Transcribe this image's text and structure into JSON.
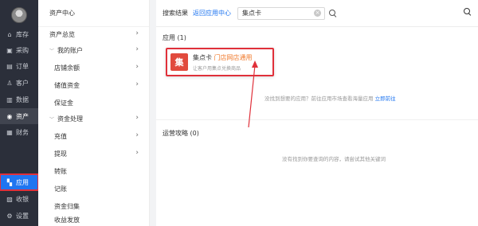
{
  "nav": {
    "items": [
      {
        "label": "库存",
        "icon": "home-icon",
        "glyph": "⌂"
      },
      {
        "label": "采购",
        "icon": "shop-icon",
        "glyph": "▣"
      },
      {
        "label": "订单",
        "icon": "order-icon",
        "glyph": "▤"
      },
      {
        "label": "客户",
        "icon": "user-icon",
        "glyph": "♙"
      },
      {
        "label": "数据",
        "icon": "chart-icon",
        "glyph": "▥"
      },
      {
        "label": "资产",
        "icon": "asset-icon",
        "glyph": "◉"
      },
      {
        "label": "财务",
        "icon": "finance-icon",
        "glyph": "▦"
      },
      {
        "label": "应用",
        "icon": "apps-icon",
        "glyph": "▚"
      },
      {
        "label": "收银",
        "icon": "cashier-icon",
        "glyph": "▨"
      },
      {
        "label": "设置",
        "icon": "settings-icon",
        "glyph": "⚙"
      }
    ]
  },
  "submenu": {
    "header": "资产中心",
    "items": [
      {
        "label": "资产总览",
        "chevron": "›"
      },
      {
        "label": "我的账户",
        "chevron": "›",
        "expanded": true
      },
      {
        "label": "店铺余额",
        "chevron": "›"
      },
      {
        "label": "储值资金",
        "chevron": "›"
      },
      {
        "label": "保证金",
        "chevron": ""
      },
      {
        "label": "资金处理",
        "chevron": "›",
        "expanded": true
      },
      {
        "label": "充值",
        "chevron": "›"
      },
      {
        "label": "提现",
        "chevron": "›"
      },
      {
        "label": "转账",
        "chevron": ""
      },
      {
        "label": "记账",
        "chevron": ""
      },
      {
        "label": "资金归集",
        "chevron": ""
      },
      {
        "label": "收益发放",
        "chevron": ""
      }
    ]
  },
  "topbar": {
    "title": "搜索结果",
    "back_link": "返回应用中心",
    "search_value": "集点卡",
    "clear_glyph": "×"
  },
  "apps_section": {
    "title": "应用 (1)",
    "card": {
      "icon_text": "集",
      "name": "集点卡",
      "tag": "门店网店通用",
      "desc": "让客户用集点兑换商品"
    },
    "empty_tip": "没找到想要的应用？前往应用市场查看海量应用",
    "empty_link": "立即前往"
  },
  "guides_section": {
    "title": "运营攻略 (0)",
    "empty_tip": "没有找到你要查询的内容，请尝试其他关键词"
  },
  "colors": {
    "nav_bg": "#2b2f3a",
    "accent": "#1f75f0",
    "highlight_border": "#e0303a",
    "app_icon": "#e14a3d",
    "tag": "#f07a2c"
  }
}
